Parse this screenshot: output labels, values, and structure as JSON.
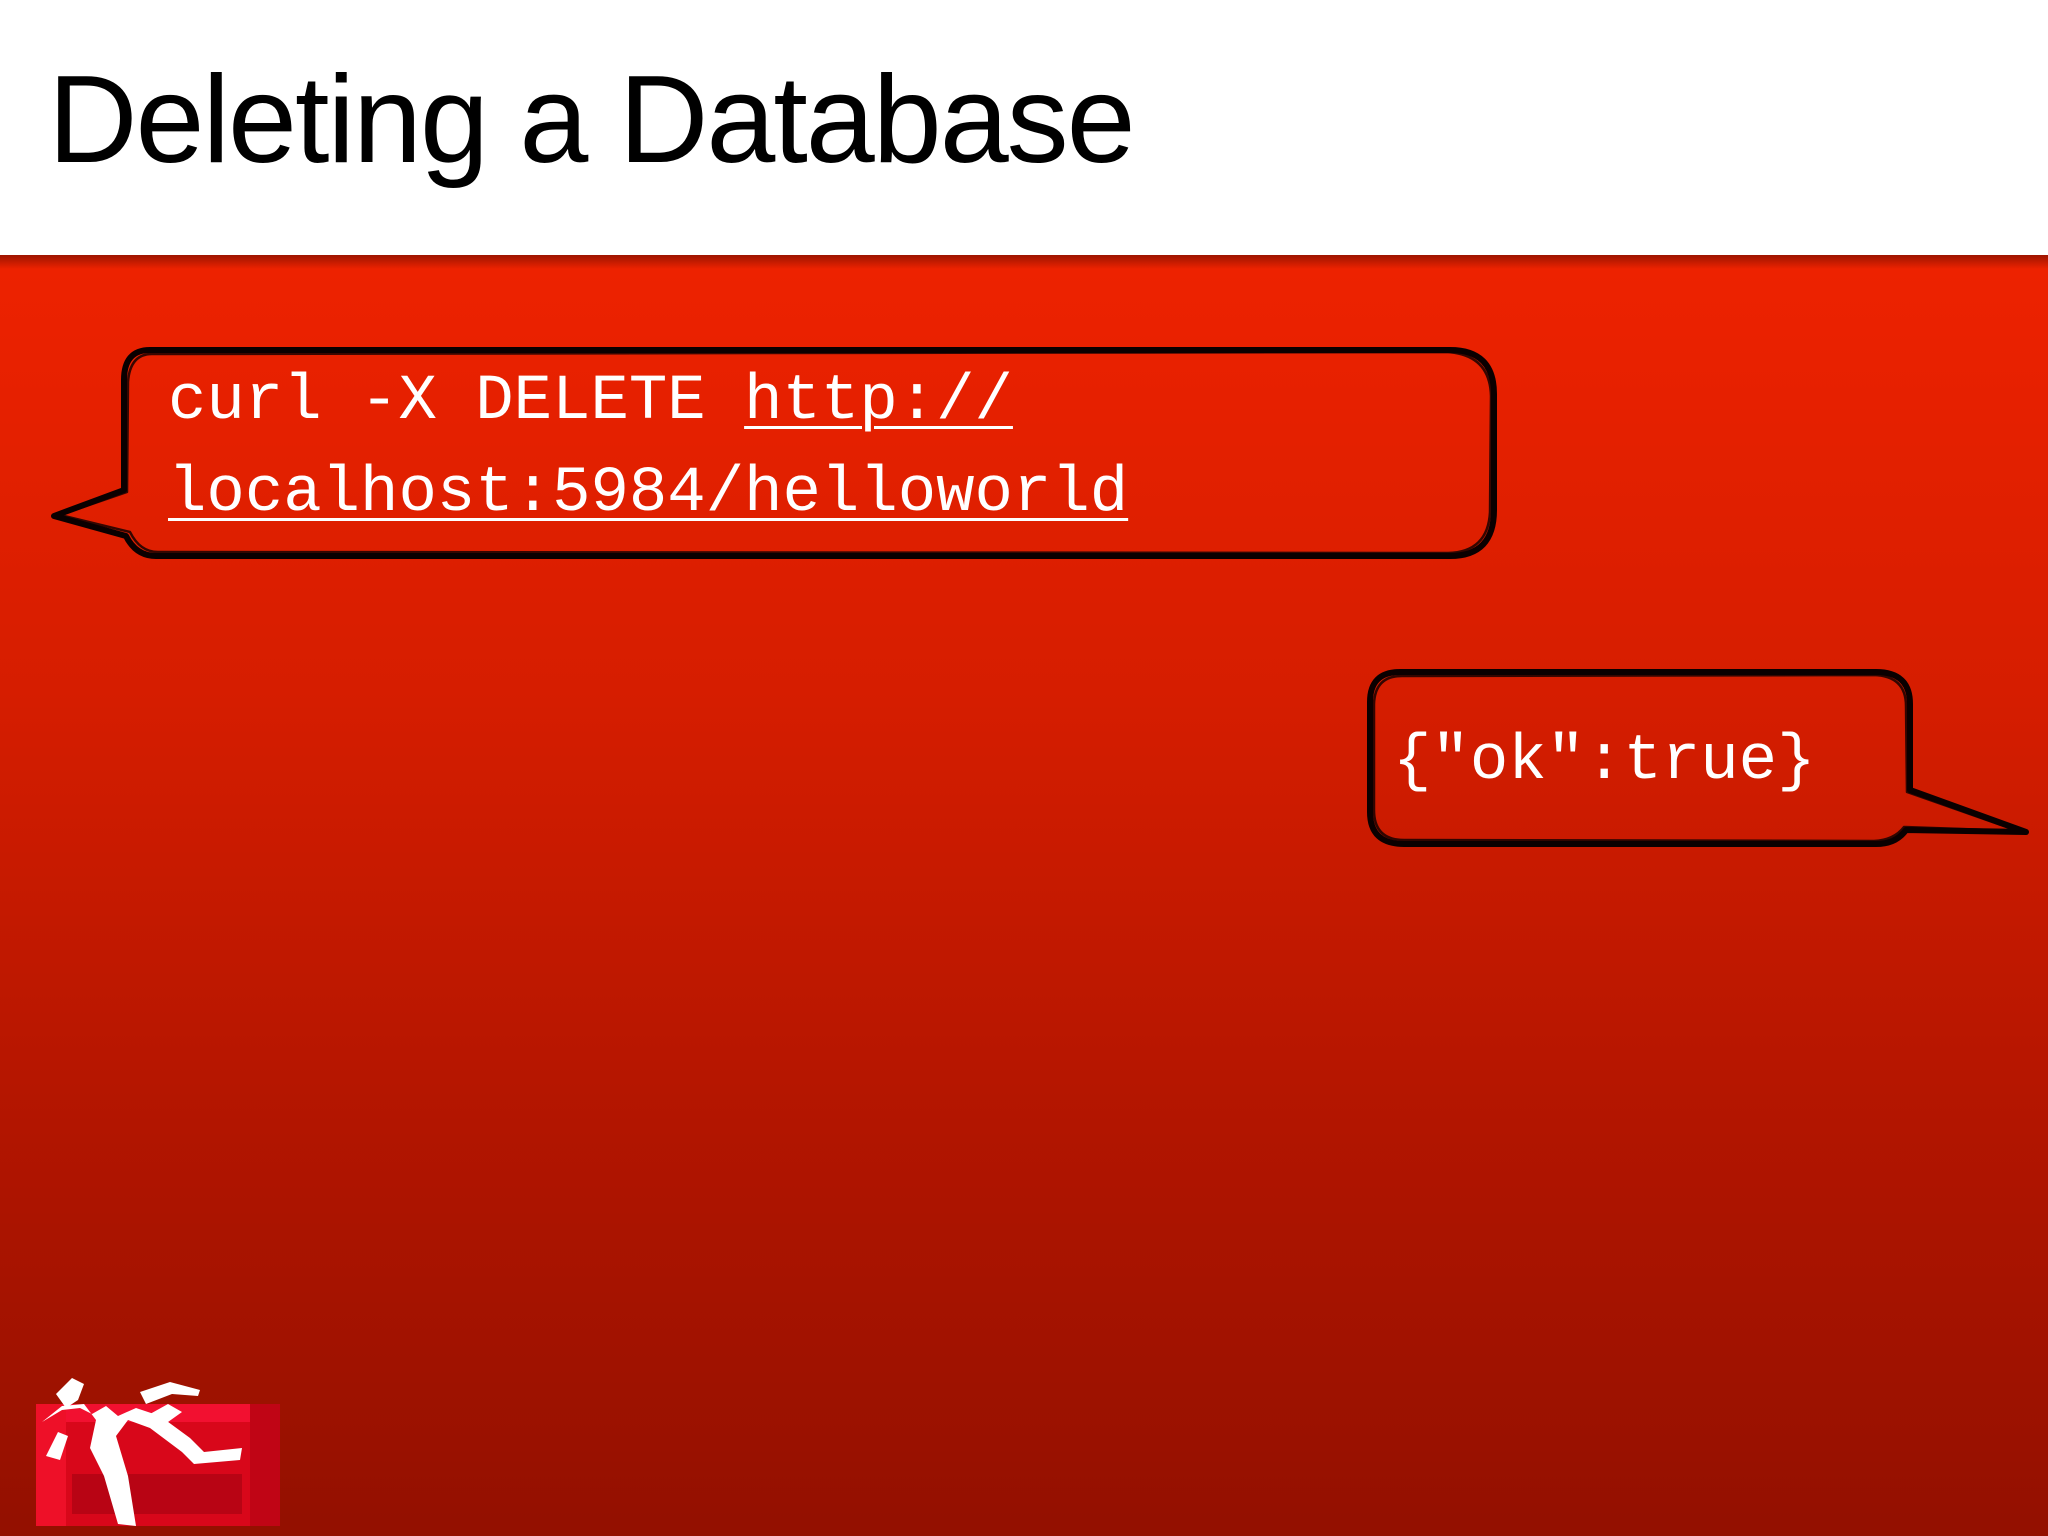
{
  "slide": {
    "title": "Deleting a Database",
    "colors": {
      "background_top": "#ee2200",
      "background_bottom": "#931000",
      "title_bar": "#ffffff",
      "text": "#ffffff"
    }
  },
  "request_bubble": {
    "command_prefix": "curl -X DELETE ",
    "url_part1": "http://",
    "url_part2": "localhost:5984/helloworld"
  },
  "response_bubble": {
    "text": "{\"ok\":true}"
  },
  "logo": {
    "icon": "couchdb-relaxing-figure-icon"
  }
}
